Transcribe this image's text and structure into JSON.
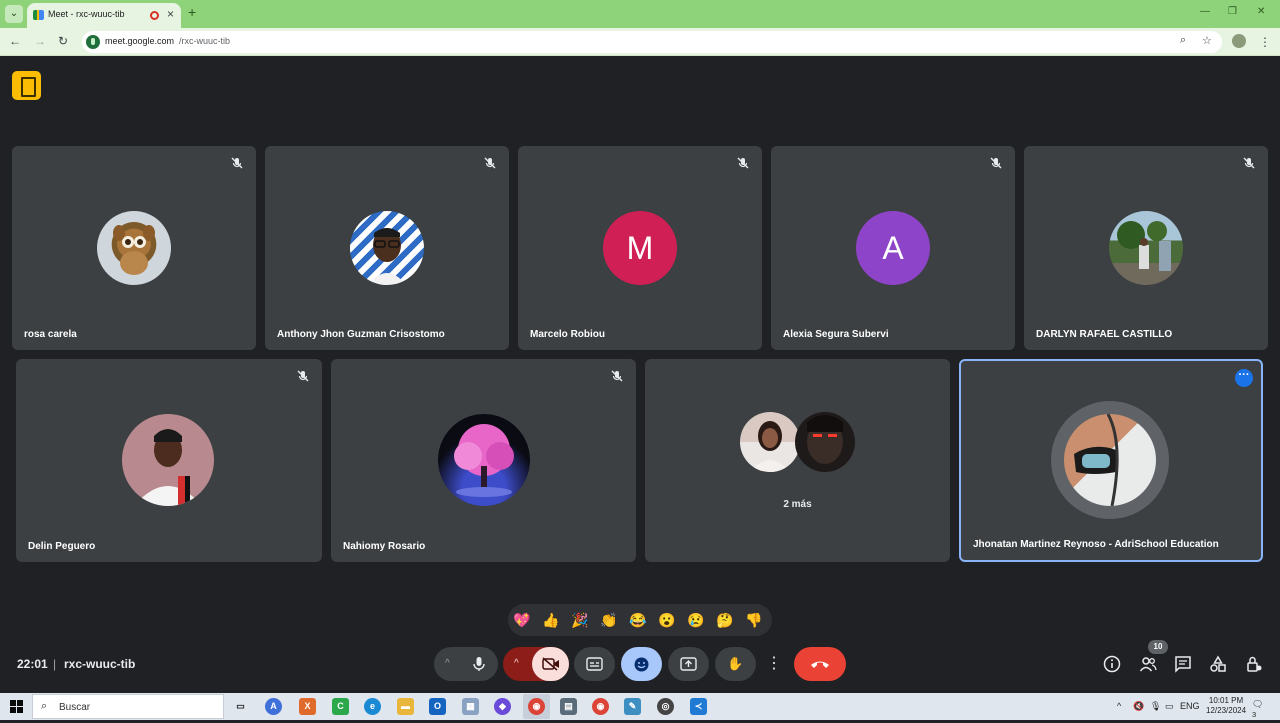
{
  "browser": {
    "tab_title": "Meet - rxc-wuuc-tib",
    "url_host": "meet.google.com",
    "url_path": "/rxc-wuuc-tib"
  },
  "participants_row1": [
    {
      "name": "rosa carela",
      "avatar": "cartoon-lemur",
      "muted": true
    },
    {
      "name": "Anthony Jhon Guzman Crisostomo",
      "avatar": "photo-man-glasses",
      "muted": true
    },
    {
      "name": "Marcelo Robiou",
      "letter": "M",
      "color": "#d01f55",
      "muted": true
    },
    {
      "name": "Alexia Segura Subervi",
      "letter": "A",
      "color": "#8e44c8",
      "muted": true
    },
    {
      "name": "DARLYN RAFAEL CASTILLO",
      "avatar": "photo-outdoor",
      "muted": true
    }
  ],
  "participants_row2": [
    {
      "name": "Delin Peguero",
      "avatar": "photo-soccer-player",
      "muted": true
    },
    {
      "name": "Nahiomy Rosario",
      "avatar": "pink-tree",
      "muted": true
    },
    {
      "others": "2 más"
    },
    {
      "name": "Jhonatan Martinez Reynoso - AdriSchool Education",
      "avatar": "photo-sunglasses",
      "active": true
    }
  ],
  "reactions": [
    "💖",
    "👍",
    "🎉",
    "👏",
    "😂",
    "😮",
    "😢",
    "🤔",
    "👎"
  ],
  "bottom_bar": {
    "time": "22:01",
    "separator": "|",
    "meeting_code": "rxc-wuuc-tib",
    "people_count": "10"
  },
  "taskbar": {
    "search_placeholder": "Buscar",
    "language": "ENG",
    "time": "10:01 PM",
    "date": "12/23/2024",
    "notifications": "3"
  },
  "colors": {
    "background": "#202124",
    "tile": "#3c4043",
    "active_border": "#8ab4f8",
    "end_call": "#ea4335",
    "browser_frame": "#8ed37a"
  }
}
